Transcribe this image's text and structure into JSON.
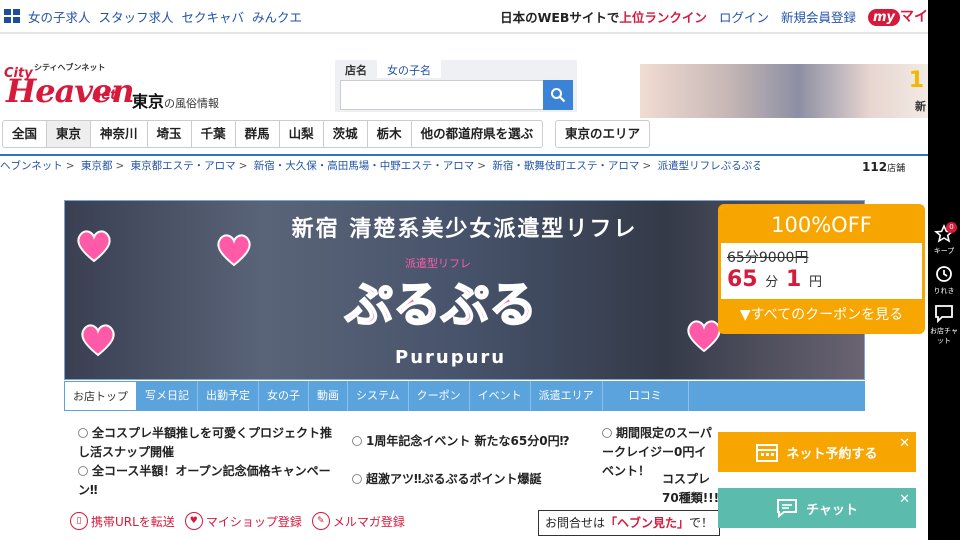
{
  "topbar": {
    "links": [
      "女の子求人",
      "スタッフ求人",
      "セクキャバ",
      "みんクエ"
    ],
    "web_text_a": "日本のWEBサイトで",
    "web_text_b": "上位ランクイン",
    "login": "ログイン",
    "register": "新規会員登録",
    "my_badge": "my",
    "my_text": "マイ"
  },
  "logo": {
    "sub": "シティヘブンネット",
    "city": "City",
    "heaven": "Heaven",
    "net": "net"
  },
  "region_title": {
    "main": "東京",
    "sub": "の風俗情報"
  },
  "search": {
    "tab_active": "店名",
    "tab_inactive": "女の子名",
    "placeholder": ""
  },
  "ad": {
    "num": "1",
    "caption": "新"
  },
  "regions": [
    "全国",
    "東京",
    "神奈川",
    "埼玉",
    "千葉",
    "群馬",
    "山梨",
    "茨城",
    "栃木",
    "他の都道府県を選ぶ"
  ],
  "area_button": "東京のエリア",
  "breadcrumb": [
    "ヘブンネット",
    "東京都",
    "東京都エステ・アロマ",
    "新宿・大久保・高田馬場・中野エステ・アロマ",
    "新宿・歌舞伎町エステ・アロマ",
    "派遣型リフレぷるぷる新宿"
  ],
  "shop_count": {
    "num": "112",
    "unit": "店舗"
  },
  "hero": {
    "headline": "新宿 清楚系美少女派遣型リフレ",
    "type": "派遣型リフレ",
    "logo": "ぷるぷる",
    "latin": "Purupuru"
  },
  "coupon": {
    "title": "100%OFF",
    "was": "65分9000円",
    "now_min": "65",
    "min_unit": "分",
    "now_yen": "1",
    "yen_unit": "円",
    "all": "▼すべてのクーポンを見る"
  },
  "shopnav": [
    "お店トップ",
    "写メ日記",
    "出勤予定",
    "女の子",
    "動画",
    "システム",
    "クーポン",
    "イベント",
    "派遣エリア",
    "口コミ"
  ],
  "news": [
    "全コスプレ半額推しを可愛くプロジェクト推し活スナップ開催",
    "全コース半額！オープン記念価格キャンペーン‼",
    "1周年記念イベント 新たな65分0円⁉",
    "超激アツ‼ぷるぷるポイント爆誕",
    "期間限定のスーパークレイジー0円イベント！",
    "コスプレ70種類!!!"
  ],
  "links": [
    "携帯URLを転送",
    "マイショップ登録",
    "メルマガ登録"
  ],
  "contact": {
    "pre": "お問合せは",
    "bold": "「ヘブン見た」",
    "post": "で！"
  },
  "float_reserve": "ネット予約する",
  "float_chat": "チャット",
  "rail": {
    "keep": "キープ",
    "keep_count": "0",
    "history": "りれき",
    "chat": "お店チャット"
  }
}
